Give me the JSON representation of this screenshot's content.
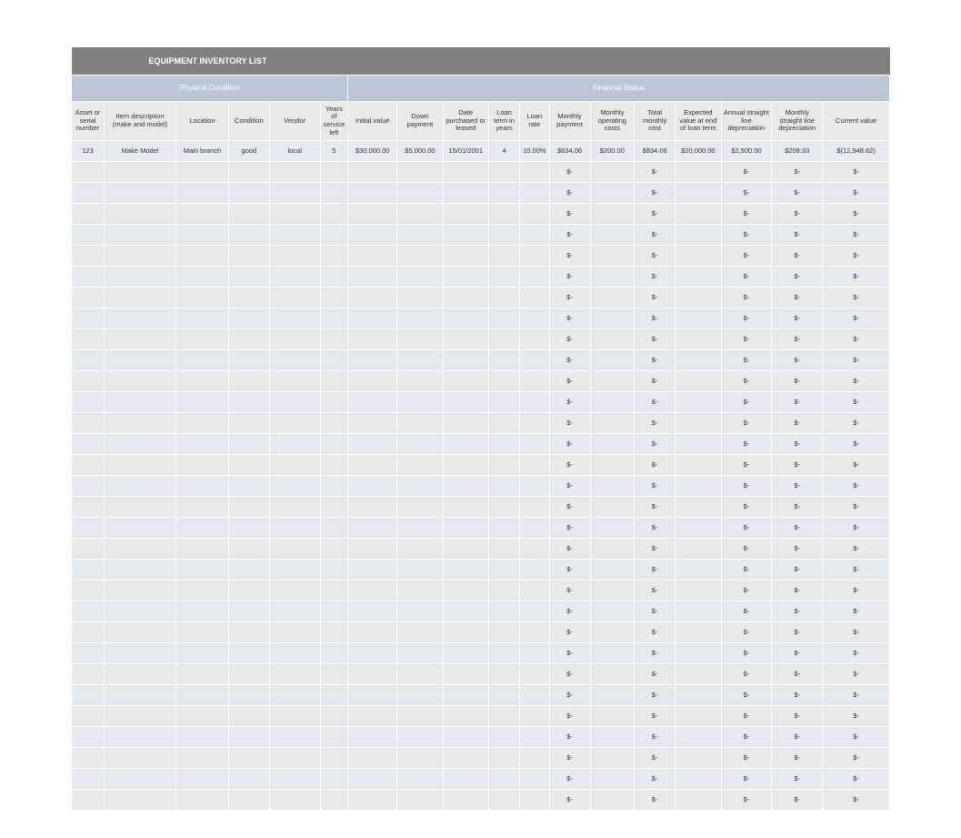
{
  "title": "EQUIPMENT INVENTORY LIST",
  "groups": {
    "physical": "Physical Condition",
    "financial": "Financial Status"
  },
  "columns": {
    "asset": "Asset or serial number",
    "desc": "Item description (make and model)",
    "loc": "Location",
    "cond": "Condition",
    "vendor": "Vendor",
    "years": "Years of service left",
    "init": "Initial value",
    "down": "Down payment",
    "date": "Date purchased or leased",
    "term": "Loan term in years",
    "rate": "Loan rate",
    "mpay": "Monthly payment",
    "mop": "Monthly operating costs",
    "tot": "Total monthly cost",
    "exp": "Expected value at end of loan term",
    "adep": "Annual straight line depreciation",
    "mdep": "Monthly straight line depreciation",
    "curr": "Current value"
  },
  "rows": [
    {
      "asset": "123",
      "desc": "Make Model",
      "loc": "Main branch",
      "cond": "good",
      "vendor": "local",
      "years": "5",
      "init": "$30,000.00",
      "down": "$5,000.00",
      "date": "15/01/2001",
      "term": "4",
      "rate": "10.00%",
      "mpay": "$634.06",
      "mop": "$200.00",
      "tot": "$834.06",
      "exp": "$20,000.00",
      "adep": "$2,500.00",
      "mdep": "$208.33",
      "curr": "$(12,948.82)"
    },
    {
      "mpay": "$-",
      "tot": "$-",
      "adep": "$-",
      "mdep": "$-",
      "curr": "$-"
    },
    {
      "mpay": "$-",
      "tot": "$-",
      "adep": "$-",
      "mdep": "$-",
      "curr": "$-"
    },
    {
      "mpay": "$-",
      "tot": "$-",
      "adep": "$-",
      "mdep": "$-",
      "curr": "$-"
    },
    {
      "mpay": "$-",
      "tot": "$-",
      "adep": "$-",
      "mdep": "$-",
      "curr": "$-"
    },
    {
      "mpay": "$-",
      "tot": "$-",
      "adep": "$-",
      "mdep": "$-",
      "curr": "$-"
    },
    {
      "mpay": "$-",
      "tot": "$-",
      "adep": "$-",
      "mdep": "$-",
      "curr": "$-"
    },
    {
      "mpay": "$-",
      "tot": "$-",
      "adep": "$-",
      "mdep": "$-",
      "curr": "$-"
    },
    {
      "mpay": "$-",
      "tot": "$-",
      "adep": "$-",
      "mdep": "$-",
      "curr": "$-"
    },
    {
      "mpay": "$-",
      "tot": "$-",
      "adep": "$-",
      "mdep": "$-",
      "curr": "$-"
    },
    {
      "mpay": "$-",
      "tot": "$-",
      "adep": "$-",
      "mdep": "$-",
      "curr": "$-"
    },
    {
      "mpay": "$-",
      "tot": "$-",
      "adep": "$-",
      "mdep": "$-",
      "curr": "$-"
    },
    {
      "mpay": "$-",
      "tot": "$-",
      "adep": "$-",
      "mdep": "$-",
      "curr": "$-"
    },
    {
      "mpay": "$-",
      "tot": "$-",
      "adep": "$-",
      "mdep": "$-",
      "curr": "$-"
    },
    {
      "mpay": "$-",
      "tot": "$-",
      "adep": "$-",
      "mdep": "$-",
      "curr": "$-"
    },
    {
      "mpay": "$-",
      "tot": "$-",
      "adep": "$-",
      "mdep": "$-",
      "curr": "$-"
    },
    {
      "mpay": "$-",
      "tot": "$-",
      "adep": "$-",
      "mdep": "$-",
      "curr": "$-"
    },
    {
      "mpay": "$-",
      "tot": "$-",
      "adep": "$-",
      "mdep": "$-",
      "curr": "$-"
    },
    {
      "mpay": "$-",
      "tot": "$-",
      "adep": "$-",
      "mdep": "$-",
      "curr": "$-"
    },
    {
      "mpay": "$-",
      "tot": "$-",
      "adep": "$-",
      "mdep": "$-",
      "curr": "$-"
    },
    {
      "mpay": "$-",
      "tot": "$-",
      "adep": "$-",
      "mdep": "$-",
      "curr": "$-"
    },
    {
      "mpay": "$-",
      "tot": "$-",
      "adep": "$-",
      "mdep": "$-",
      "curr": "$-"
    },
    {
      "mpay": "$-",
      "tot": "$-",
      "adep": "$-",
      "mdep": "$-",
      "curr": "$-"
    },
    {
      "mpay": "$-",
      "tot": "$-",
      "adep": "$-",
      "mdep": "$-",
      "curr": "$-"
    },
    {
      "mpay": "$-",
      "tot": "$-",
      "adep": "$-",
      "mdep": "$-",
      "curr": "$-"
    },
    {
      "mpay": "$-",
      "tot": "$-",
      "adep": "$-",
      "mdep": "$-",
      "curr": "$-"
    },
    {
      "mpay": "$-",
      "tot": "$-",
      "adep": "$-",
      "mdep": "$-",
      "curr": "$-"
    },
    {
      "mpay": "$-",
      "tot": "$-",
      "adep": "$-",
      "mdep": "$-",
      "curr": "$-"
    },
    {
      "mpay": "$-",
      "tot": "$-",
      "adep": "$-",
      "mdep": "$-",
      "curr": "$-"
    },
    {
      "mpay": "$-",
      "tot": "$-",
      "adep": "$-",
      "mdep": "$-",
      "curr": "$-"
    },
    {
      "mpay": "$-",
      "tot": "$-",
      "adep": "$-",
      "mdep": "$-",
      "curr": "$-"
    },
    {
      "mpay": "$-",
      "tot": "$-",
      "adep": "$-",
      "mdep": "$-",
      "curr": "$-"
    }
  ],
  "col_order": [
    "asset",
    "desc",
    "loc",
    "cond",
    "vendor",
    "years",
    "init",
    "down",
    "date",
    "term",
    "rate",
    "mpay",
    "mop",
    "tot",
    "exp",
    "adep",
    "mdep",
    "curr"
  ]
}
